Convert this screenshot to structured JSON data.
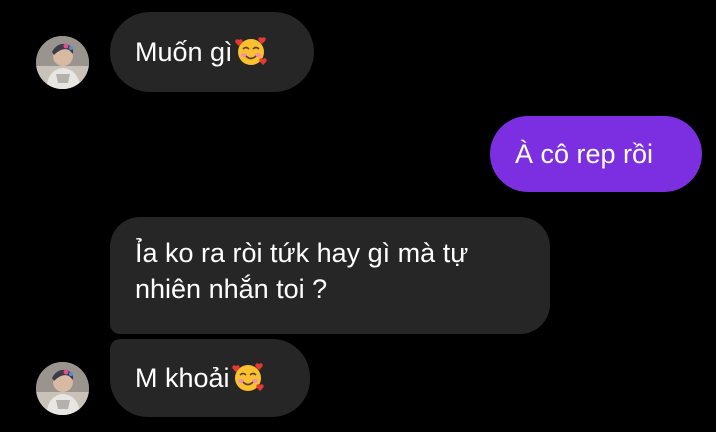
{
  "conversation": {
    "messages": [
      {
        "sender": "contact",
        "text": "Muốn gì",
        "emoji": "smiling-face-with-hearts"
      },
      {
        "sender": "me",
        "text": "À cô rep rồi"
      },
      {
        "sender": "contact",
        "text": "Ỉa ko ra ròi tứk hay gì mà tự nhiên nhắn toi ?"
      },
      {
        "sender": "contact",
        "text": "M khoải",
        "emoji": "smiling-face-with-hearts"
      }
    ]
  },
  "colors": {
    "background": "#000000",
    "incoming_bubble": "#262626",
    "outgoing_bubble": "#7b2fe0",
    "text": "#ffffff"
  }
}
